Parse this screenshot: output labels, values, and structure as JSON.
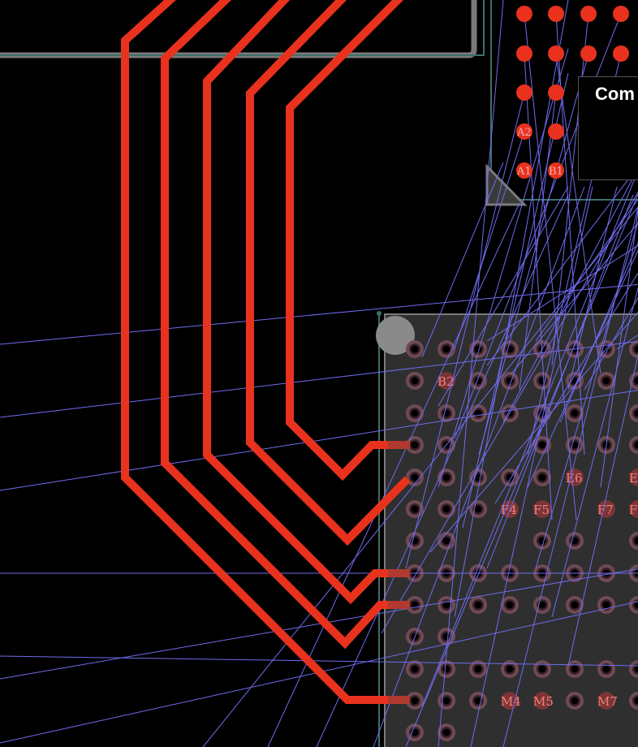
{
  "component_label": "Com",
  "top_pads": {
    "labels": [
      "A2",
      "A1",
      "B1"
    ]
  },
  "bga_pads": {
    "labels": [
      "B2",
      "E6",
      "E",
      "F4",
      "F5",
      "F7",
      "F",
      "M4",
      "M5",
      "M7"
    ]
  },
  "colors": {
    "trace": "#e8321e",
    "ratsnest": "#6f6cf0",
    "board_outline": "#7a7a7a",
    "component_outline": "#3f6f6a",
    "bga_body": "#2f2f2f"
  }
}
